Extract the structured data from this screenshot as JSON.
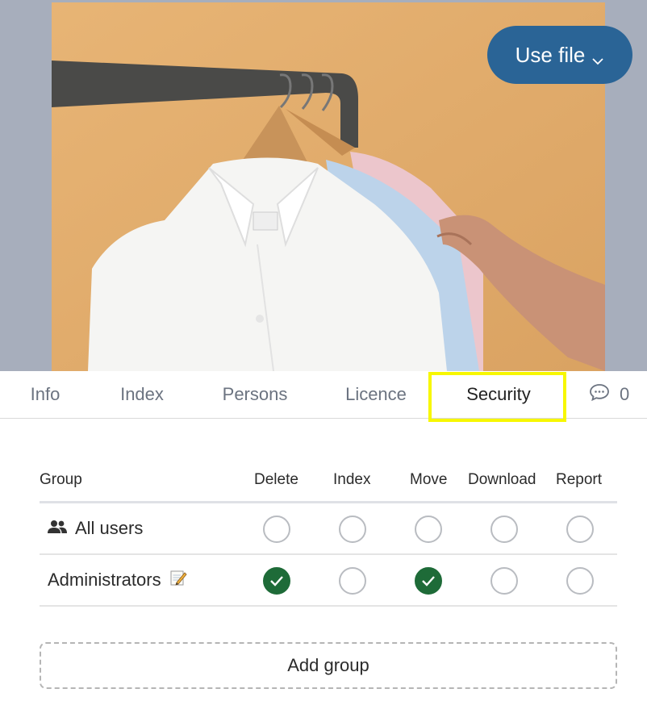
{
  "preview": {
    "image_subject": "shirts on hangers",
    "use_file_label": "Use file"
  },
  "tabs": [
    {
      "label": "Info"
    },
    {
      "label": "Index"
    },
    {
      "label": "Persons"
    },
    {
      "label": "Licence"
    },
    {
      "label": "Security",
      "active": true
    }
  ],
  "comments": {
    "count": "0",
    "icon": "chat-bubble-icon"
  },
  "security": {
    "columns": {
      "group": "Group",
      "delete": "Delete",
      "index": "Index",
      "move": "Move",
      "download": "Download",
      "report": "Report"
    },
    "rows": [
      {
        "name": "All users",
        "icon": "users-icon",
        "delete": false,
        "index": false,
        "move": false,
        "download": false,
        "report": false
      },
      {
        "name": "Administrators",
        "icon": "memo-icon",
        "delete": true,
        "index": false,
        "move": true,
        "download": false,
        "report": false
      }
    ],
    "add_group_label": "Add group"
  },
  "colors": {
    "accent": "#2a6496",
    "checked": "#1e6b38",
    "highlight": "#f7f700"
  }
}
